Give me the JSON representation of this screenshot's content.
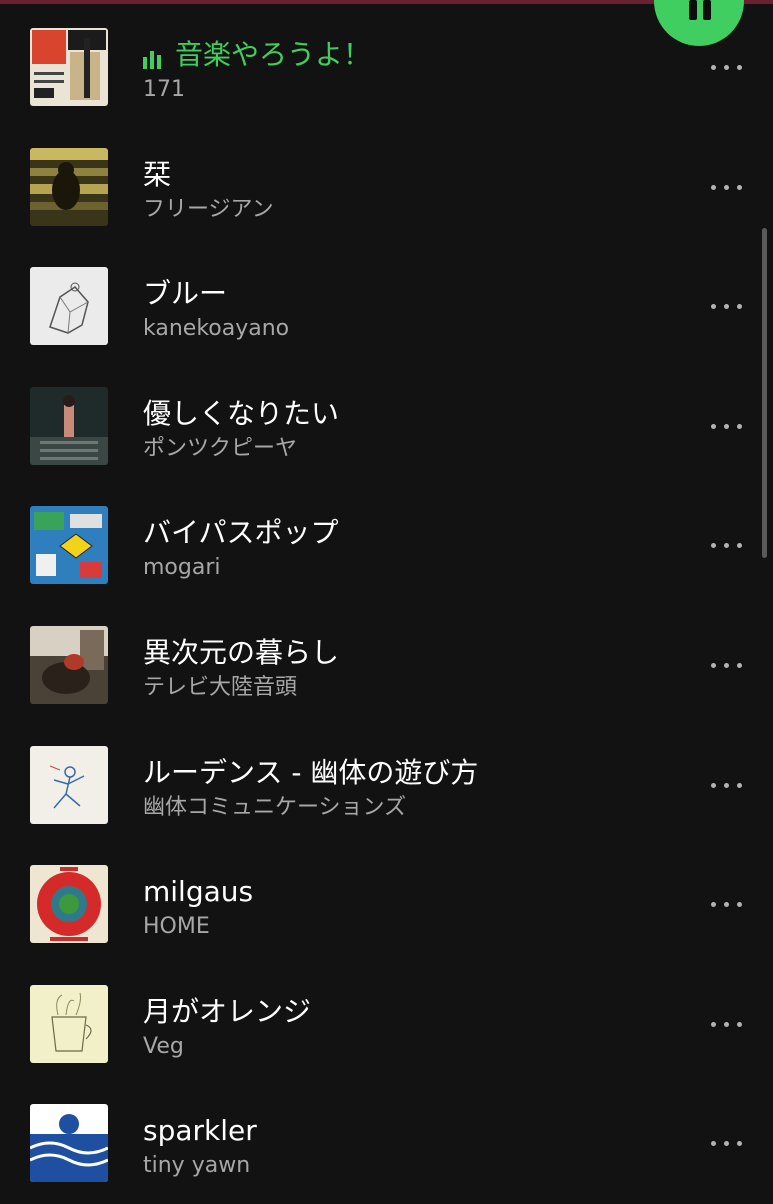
{
  "player": {
    "pause_icon": "pause-icon",
    "accent_color": "#3fce5f"
  },
  "tracks": [
    {
      "title": "音楽やろうよ！",
      "artist": "171",
      "playing": true
    },
    {
      "title": "栞",
      "artist": "フリージアン",
      "playing": false
    },
    {
      "title": "ブルー",
      "artist": "kanekoayano",
      "playing": false
    },
    {
      "title": "優しくなりたい",
      "artist": "ポンツクピーヤ",
      "playing": false
    },
    {
      "title": "バイパスポップ",
      "artist": "mogari",
      "playing": false
    },
    {
      "title": "異次元の暮らし",
      "artist": "テレビ大陸音頭",
      "playing": false
    },
    {
      "title": "ルーデンス - 幽体の遊び方",
      "artist": "幽体コミュニケーションズ",
      "playing": false
    },
    {
      "title": "milgaus",
      "artist": "HOME",
      "playing": false
    },
    {
      "title": "月がオレンジ",
      "artist": "Veg",
      "playing": false
    },
    {
      "title": "sparkler",
      "artist": "tiny yawn",
      "playing": false
    }
  ],
  "row_menu_icon": "more-options-icon"
}
